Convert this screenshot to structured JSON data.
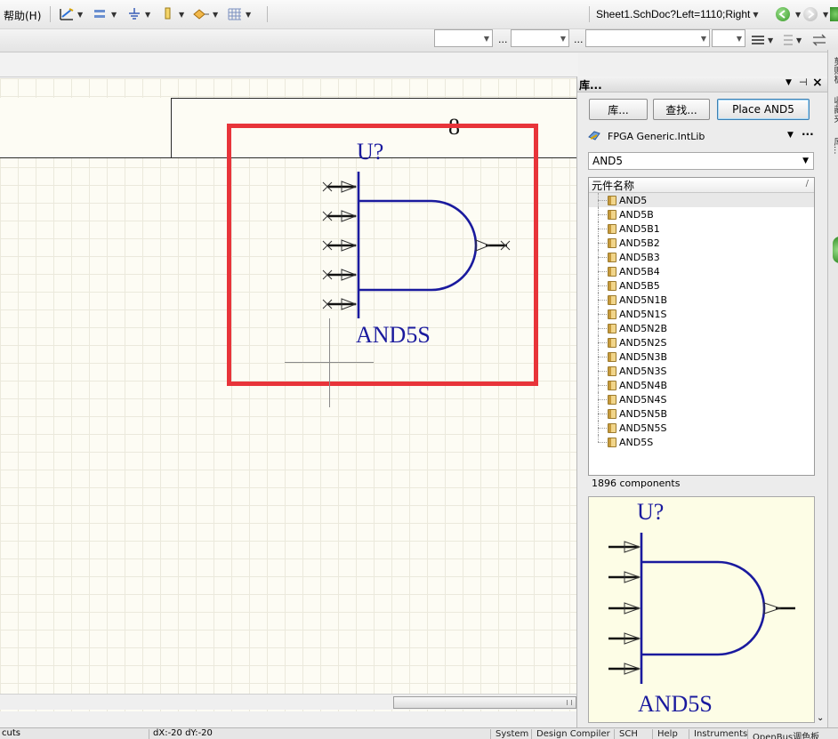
{
  "menubar": {
    "help_label": "帮助(H)"
  },
  "toolbar": {
    "icons": [
      "wire-draw-icon",
      "bus-icon",
      "ground-icon",
      "port-icon",
      "net-label-icon",
      "grid-icon"
    ],
    "doc_path": "Sheet1.SchDoc?Left=1110;Right"
  },
  "toolbar2": {
    "ellipsis": "..."
  },
  "sheet": {
    "grid_number": "8",
    "designator": "U?",
    "component_comment": "AND5S"
  },
  "panel": {
    "title": "库...",
    "buttons": {
      "libraries": "库...",
      "search": "查找...",
      "place": "Place AND5"
    },
    "library_selector": "FPGA Generic.IntLib",
    "filter_value": "AND5",
    "list_header": "元件名称",
    "sort_indicator": "/",
    "items": [
      "AND5",
      "AND5B",
      "AND5B1",
      "AND5B2",
      "AND5B3",
      "AND5B4",
      "AND5B5",
      "AND5N1B",
      "AND5N1S",
      "AND5N2B",
      "AND5N2S",
      "AND5N3B",
      "AND5N3S",
      "AND5N4B",
      "AND5N4S",
      "AND5N5B",
      "AND5N5S",
      "AND5S"
    ],
    "component_count": "1896 components",
    "preview": {
      "designator": "U?",
      "comment": "AND5S"
    }
  },
  "side_tabs": [
    "剪贴板",
    "收藏夹",
    "库..."
  ],
  "statusbar": {
    "left_text": "cuts",
    "coords": "dX:-20 dY:-20",
    "tabs": [
      "System",
      "Design Compiler",
      "SCH",
      "Help",
      "Instruments",
      "OpenBus调色板"
    ]
  },
  "colors": {
    "highlight_box": "#e8343a",
    "schematic_blue": "#1a1a9e",
    "sheet_bg": "#fdfcf4",
    "preview_bg": "#fdfde6"
  }
}
